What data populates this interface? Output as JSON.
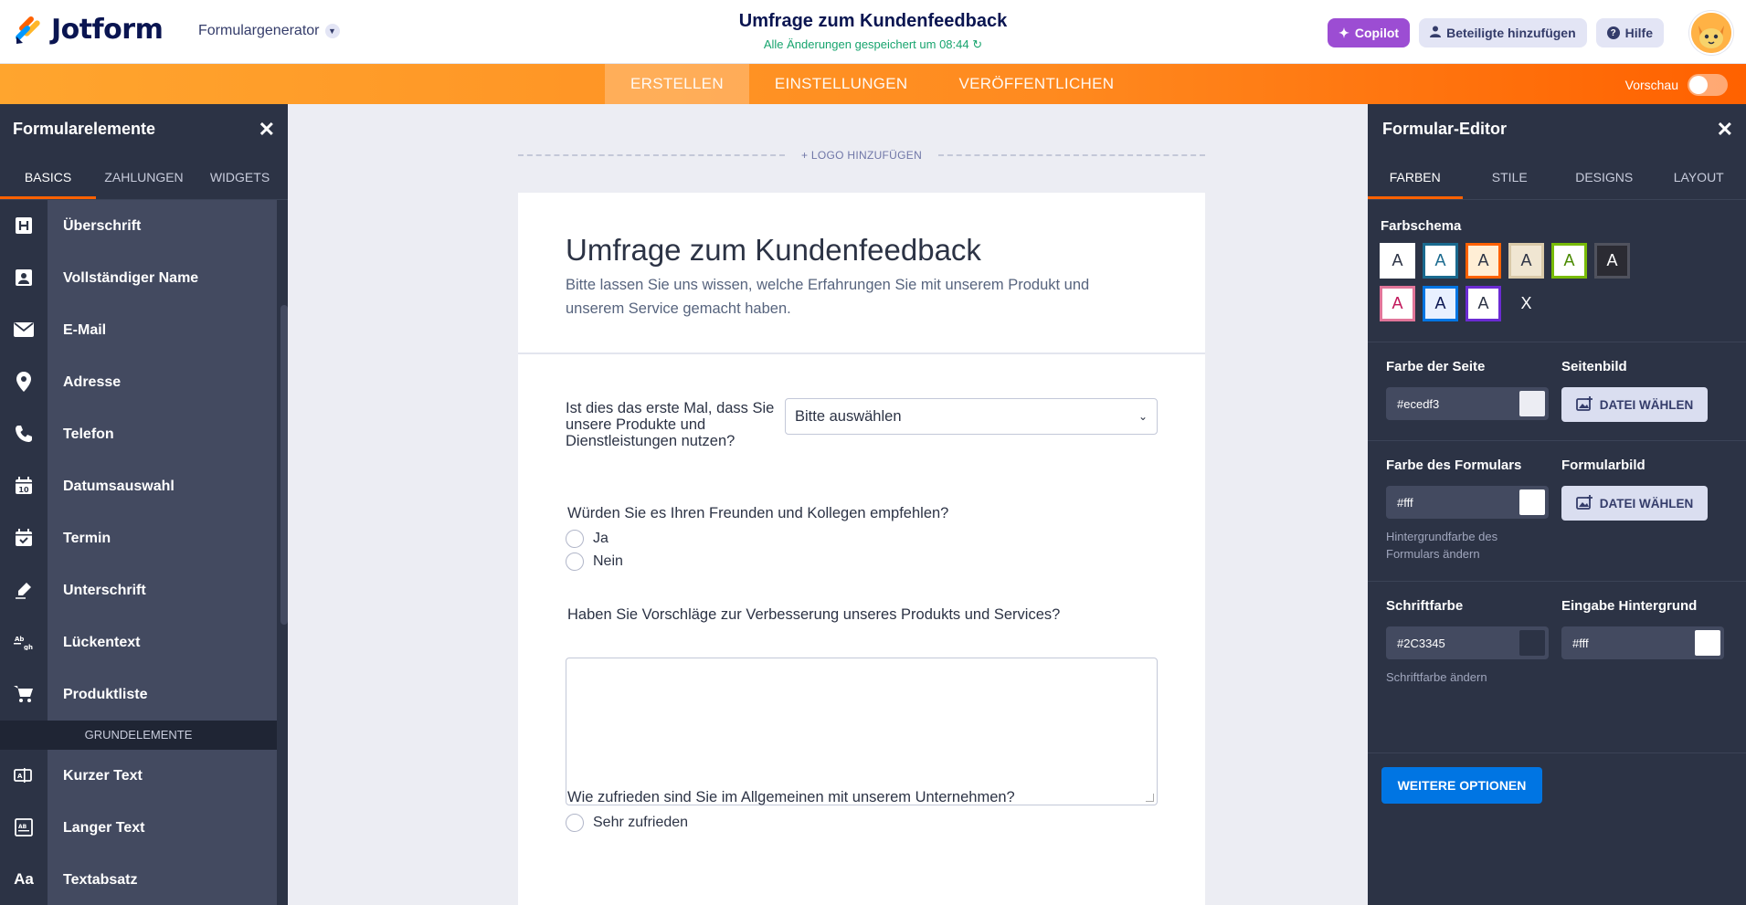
{
  "header": {
    "brand": "Jotform",
    "generator": "Formulargenerator",
    "title": "Umfrage zum Kundenfeedback",
    "saved_status": "Alle Änderungen gespeichert um 08:44",
    "copilot": "Copilot",
    "add_participants": "Beteiligte hinzufügen",
    "help": "Hilfe"
  },
  "nav": {
    "tabs": [
      "ERSTELLEN",
      "EINSTELLUNGEN",
      "VERÖFFENTLICHEN"
    ],
    "active": "ERSTELLEN",
    "preview": "Vorschau"
  },
  "left_panel": {
    "title": "Formularelemente",
    "tabs": [
      "BASICS",
      "ZAHLUNGEN",
      "WIDGETS"
    ],
    "items": [
      {
        "label": "Überschrift",
        "icon": "heading-icon"
      },
      {
        "label": "Vollständiger Name",
        "icon": "user-card-icon"
      },
      {
        "label": "E-Mail",
        "icon": "envelope-icon"
      },
      {
        "label": "Adresse",
        "icon": "map-pin-icon"
      },
      {
        "label": "Telefon",
        "icon": "phone-icon"
      },
      {
        "label": "Datumsauswahl",
        "icon": "calendar-icon"
      },
      {
        "label": "Termin",
        "icon": "calendar-check-icon"
      },
      {
        "label": "Unterschrift",
        "icon": "pen-icon"
      },
      {
        "label": "Lückentext",
        "icon": "fill-blank-icon"
      },
      {
        "label": "Produktliste",
        "icon": "cart-icon"
      }
    ],
    "section": "GRUNDELEMENTE",
    "items2": [
      {
        "label": "Kurzer Text",
        "icon": "short-text-icon"
      },
      {
        "label": "Langer Text",
        "icon": "long-text-icon"
      },
      {
        "label": "Textabsatz",
        "icon": "paragraph-icon"
      }
    ]
  },
  "form": {
    "logo_add": "+ LOGO HINZUFÜGEN",
    "title": "Umfrage zum Kundenfeedback",
    "description": "Bitte lassen Sie uns wissen, welche Erfahrungen Sie mit unserem Produkt und unserem Service gemacht haben.",
    "q1": {
      "label": "Ist dies das erste Mal, dass Sie unsere Produkte und Dienstleistungen nutzen?",
      "placeholder": "Bitte auswählen"
    },
    "q2": {
      "label": "Würden Sie es Ihren Freunden und Kollegen empfehlen?",
      "options": [
        "Ja",
        "Nein"
      ]
    },
    "q3": {
      "label": "Haben Sie Vorschläge zur Verbesserung unseres Produkts und Services?"
    },
    "q4": {
      "label": "Wie zufrieden sind Sie im Allgemeinen mit unserem Unternehmen?",
      "options": [
        "Sehr zufrieden"
      ]
    }
  },
  "right_panel": {
    "title": "Formular-Editor",
    "tabs": [
      "FARBEN",
      "STILE",
      "DESIGNS",
      "LAYOUT"
    ],
    "scheme_title": "Farbschema",
    "swatches": [
      {
        "label": "A",
        "bg": "#ffffff",
        "border": "#ffffff",
        "fg": "#2c3345"
      },
      {
        "label": "A",
        "bg": "#ffffff",
        "border": "#1a6a8f",
        "fg": "#1a6a8f"
      },
      {
        "label": "A",
        "bg": "#ffeed5",
        "border": "#ff6100",
        "fg": "#2c3345"
      },
      {
        "label": "A",
        "bg": "#f0e6d2",
        "border": "#d9c9a8",
        "fg": "#2c3345"
      },
      {
        "label": "A",
        "bg": "#ffffff",
        "border": "#78bb07",
        "fg": "#4a8a00"
      },
      {
        "label": "A",
        "bg": "#2b2b33",
        "border": "#50525e",
        "fg": "#ffffff"
      },
      {
        "label": "A",
        "bg": "#ffffff",
        "border": "#e17599",
        "fg": "#c2185b"
      },
      {
        "label": "A",
        "bg": "#e8f0ff",
        "border": "#0075e3",
        "fg": "#0a1551"
      },
      {
        "label": "A",
        "bg": "#ffffff",
        "border": "#6b2bd3",
        "fg": "#2c3345"
      },
      {
        "label": "X",
        "bg": "#2c3345",
        "border": "#2c3345",
        "fg": "#ffffff"
      }
    ],
    "page_color_label": "Farbe der Seite",
    "page_color": "#ecedf3",
    "page_image_label": "Seitenbild",
    "choose_file": "DATEI WÄHLEN",
    "form_color_label": "Farbe des Formulars",
    "form_color": "#fff",
    "form_color_hint": "Hintergrundfarbe des Formulars ändern",
    "form_image_label": "Formularbild",
    "font_color_label": "Schriftfarbe",
    "font_color": "#2C3345",
    "font_color_hint": "Schriftfarbe ändern",
    "input_bg_label": "Eingabe Hintergrund",
    "input_bg": "#fff",
    "more_options": "WEITERE OPTIONEN"
  }
}
